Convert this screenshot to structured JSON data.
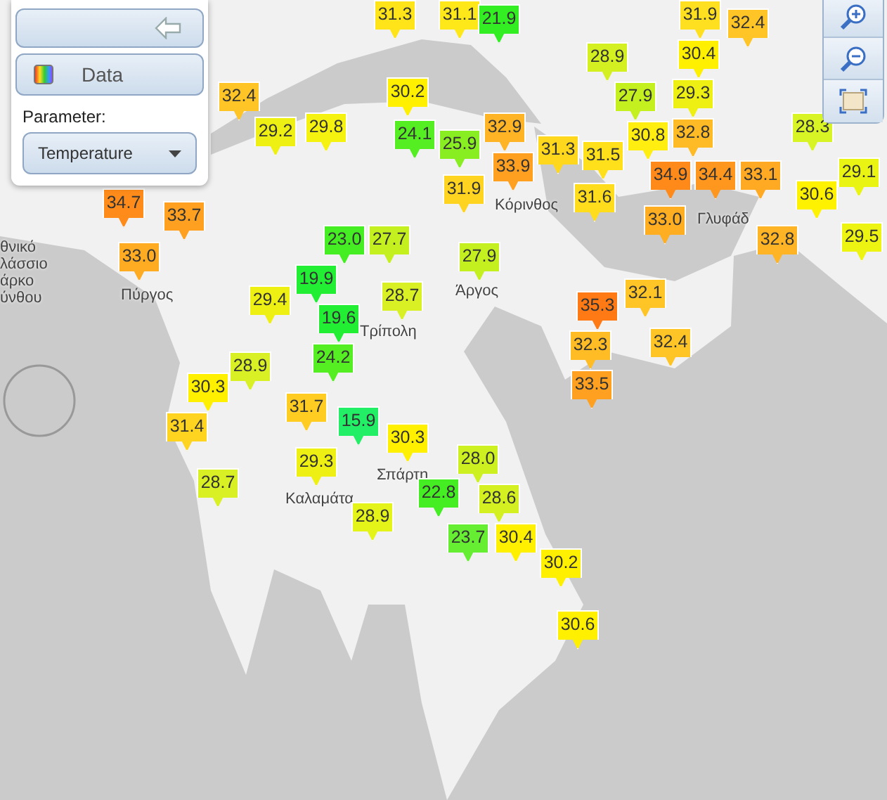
{
  "panel": {
    "expanded": true,
    "header": "Data",
    "parameter_label": "Parameter:",
    "parameter": {
      "value": "Temperature"
    }
  },
  "markers": [
    {
      "value": "31.3",
      "color": "#ffe41a"
    },
    {
      "value": "31.1",
      "color": "#ffe81a"
    },
    {
      "value": "21.9",
      "color": "#33ee22"
    },
    {
      "value": "31.9",
      "color": "#ffe020"
    },
    {
      "value": "32.4",
      "color": "#ffc425"
    },
    {
      "value": "28.9",
      "color": "#d4f020"
    },
    {
      "value": "30.4",
      "color": "#fff000"
    },
    {
      "value": "27.9",
      "color": "#c4f020"
    },
    {
      "value": "29.3",
      "color": "#eef014"
    },
    {
      "value": "30.8",
      "color": "#ffee10"
    },
    {
      "value": "32.8",
      "color": "#ffbb25"
    },
    {
      "value": "34.9",
      "color": "#ff8a1a"
    },
    {
      "value": "34.4",
      "color": "#ff961e"
    },
    {
      "value": "33.1",
      "color": "#ffaa22"
    },
    {
      "value": "28.3",
      "color": "#d8f424"
    },
    {
      "value": "30.6",
      "color": "#fff200"
    },
    {
      "value": "29.1",
      "color": "#eaf412"
    },
    {
      "value": "32.8",
      "color": "#ffb425"
    },
    {
      "value": "29.5",
      "color": "#eef412"
    },
    {
      "value": "33.0",
      "color": "#ffae22"
    },
    {
      "value": "32.4",
      "color": "#ffc425"
    },
    {
      "value": "29.2",
      "color": "#eef014"
    },
    {
      "value": "29.8",
      "color": "#f6f210"
    },
    {
      "value": "30.2",
      "color": "#fff000"
    },
    {
      "value": "24.1",
      "color": "#55ee22"
    },
    {
      "value": "25.9",
      "color": "#88ee22"
    },
    {
      "value": "32.9",
      "color": "#ffb425"
    },
    {
      "value": "33.9",
      "color": "#ffa020"
    },
    {
      "value": "31.3",
      "color": "#ffd81e"
    },
    {
      "value": "31.5",
      "color": "#ffe01a"
    },
    {
      "value": "31.9",
      "color": "#ffd420"
    },
    {
      "value": "31.6",
      "color": "#ffdc1c"
    },
    {
      "value": "34.7",
      "color": "#ff8c1a"
    },
    {
      "value": "33.7",
      "color": "#ffa020"
    },
    {
      "value": "33.0",
      "color": "#ffac22"
    },
    {
      "value": "23.0",
      "color": "#44ee22"
    },
    {
      "value": "27.7",
      "color": "#c4f020"
    },
    {
      "value": "19.9",
      "color": "#22ee33"
    },
    {
      "value": "19.6",
      "color": "#22ee33"
    },
    {
      "value": "24.2",
      "color": "#55ee22"
    },
    {
      "value": "28.7",
      "color": "#d8f024"
    },
    {
      "value": "27.9",
      "color": "#c4f020"
    },
    {
      "value": "29.4",
      "color": "#eef014"
    },
    {
      "value": "32.1",
      "color": "#ffc425"
    },
    {
      "value": "35.3",
      "color": "#ff7a14"
    },
    {
      "value": "32.3",
      "color": "#ffbc25"
    },
    {
      "value": "33.5",
      "color": "#ffa020"
    },
    {
      "value": "32.4",
      "color": "#ffc425"
    },
    {
      "value": "28.9",
      "color": "#d8f024"
    },
    {
      "value": "30.3",
      "color": "#fff000"
    },
    {
      "value": "31.4",
      "color": "#ffd420"
    },
    {
      "value": "31.7",
      "color": "#ffcc22"
    },
    {
      "value": "15.9",
      "color": "#22ee66"
    },
    {
      "value": "29.3",
      "color": "#eef014"
    },
    {
      "value": "30.3",
      "color": "#fff000"
    },
    {
      "value": "28.7",
      "color": "#d8f024"
    },
    {
      "value": "28.0",
      "color": "#ccf020"
    },
    {
      "value": "22.8",
      "color": "#44ee22"
    },
    {
      "value": "28.6",
      "color": "#d4f020"
    },
    {
      "value": "23.7",
      "color": "#66ee33"
    },
    {
      "value": "30.4",
      "color": "#fff000"
    },
    {
      "value": "28.9",
      "color": "#e4f418"
    },
    {
      "value": "30.2",
      "color": "#fff000"
    },
    {
      "value": "30.6",
      "color": "#fff000"
    }
  ],
  "places": [
    {
      "name": "Κόρινθος"
    },
    {
      "name": "Γλυφάδ"
    },
    {
      "name": "Πύργος"
    },
    {
      "name": "Τρίπολη"
    },
    {
      "name": "Άργος"
    },
    {
      "name": "Καλαμάτα"
    },
    {
      "name": "Σπάρτη"
    },
    {
      "name": "θνικό"
    },
    {
      "name": "λάσσιο"
    },
    {
      "name": "άρκο"
    },
    {
      "name": "ύνθου"
    }
  ]
}
